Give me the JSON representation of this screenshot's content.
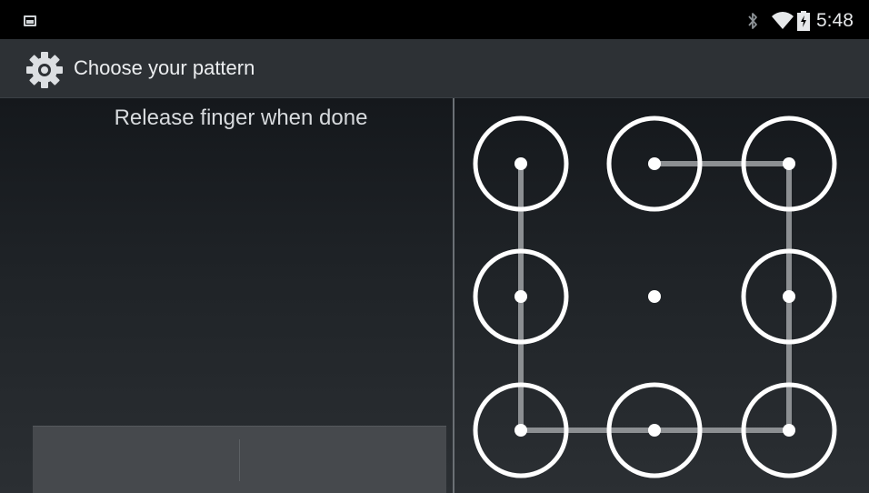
{
  "status_bar": {
    "time": "5:48",
    "icons": [
      "picture-notification-icon",
      "bluetooth-icon",
      "wifi-icon",
      "battery-icon"
    ]
  },
  "action_bar": {
    "title": "Choose your pattern",
    "icon": "settings-gear-icon"
  },
  "header": {
    "text": "Release finger when done"
  },
  "footer_buttons": {
    "cancel_label": "",
    "continue_label": ""
  },
  "pattern": {
    "grid": "3x3",
    "path": [
      2,
      3,
      6,
      9,
      8,
      7,
      4,
      1
    ],
    "untouched_dots": [
      5
    ]
  },
  "colors": {
    "status_bar": "#000000",
    "action_bar": "#2d3135",
    "pattern_circle": "#ffffff",
    "pattern_line": "#8c8f92",
    "button_bar": "#46494d"
  }
}
